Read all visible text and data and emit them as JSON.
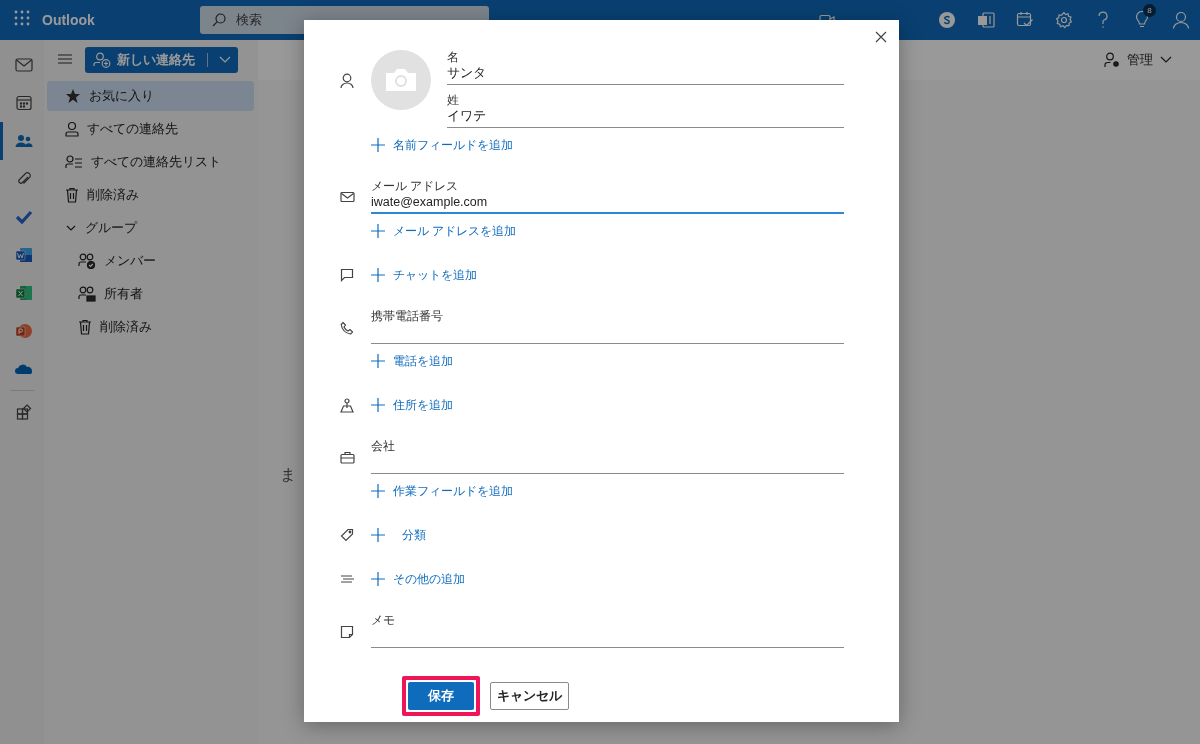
{
  "topbar": {
    "app_name": "Outlook",
    "search": {
      "placeholder": "検索"
    },
    "tips_badge": "8"
  },
  "toolbar": {
    "new_contact": "新しい連絡先",
    "manage": "管理"
  },
  "rail": [
    {
      "kind": "mail",
      "selected": false
    },
    {
      "kind": "calendar",
      "selected": false
    },
    {
      "kind": "people",
      "selected": true
    },
    {
      "kind": "files",
      "selected": false
    },
    {
      "kind": "todo",
      "selected": false
    },
    {
      "kind": "word",
      "selected": false
    },
    {
      "kind": "excel",
      "selected": false
    },
    {
      "kind": "powerpoint",
      "selected": false
    },
    {
      "kind": "onedrive",
      "selected": false
    },
    {
      "kind": "apps",
      "selected": false
    }
  ],
  "sidebar": {
    "items": [
      {
        "kind": "favorites",
        "label": "お気に入り",
        "selected": true
      },
      {
        "kind": "contacts",
        "label": "すべての連絡先",
        "selected": false
      },
      {
        "kind": "lists",
        "label": "すべての連絡先リスト",
        "selected": false
      },
      {
        "kind": "deleted",
        "label": "削除済み",
        "selected": false
      },
      {
        "kind": "group",
        "label": "グループ",
        "selected": false,
        "expanded": true,
        "children": [
          {
            "kind": "members",
            "label": "メンバー",
            "selected": false
          },
          {
            "kind": "owners",
            "label": "所有者",
            "selected": false
          },
          {
            "kind": "deleted",
            "label": "削除済み",
            "selected": false
          }
        ]
      }
    ]
  },
  "content": {
    "message": "ま"
  },
  "dialog": {
    "sections": [
      {
        "kind": "name",
        "fields": [
          {
            "label": "名",
            "value": "サンタ",
            "focused": false
          },
          {
            "label": "姓",
            "value": "イワテ",
            "focused": false
          }
        ],
        "add_link": "名前フィールドを追加"
      },
      {
        "kind": "email",
        "fields": [
          {
            "label": "メール アドレス",
            "value": "iwate@example.com",
            "focused": true
          }
        ],
        "add_link": "メール アドレスを追加"
      },
      {
        "kind": "chat",
        "add_link": "チャットを追加"
      },
      {
        "kind": "phone",
        "fields": [
          {
            "label": "携帯電話番号",
            "focused": false
          }
        ],
        "add_link": "電話を追加"
      },
      {
        "kind": "address",
        "add_link": "住所を追加"
      },
      {
        "kind": "company",
        "fields": [
          {
            "label": "会社",
            "focused": false
          }
        ],
        "add_link": "作業フィールドを追加"
      },
      {
        "kind": "category",
        "add_link": "分類"
      },
      {
        "kind": "other",
        "add_link": "その他の追加"
      },
      {
        "kind": "notes",
        "fields": [
          {
            "label": "メモ",
            "focused": false
          }
        ]
      }
    ],
    "save": {
      "label": "保存",
      "highlighted": true
    },
    "cancel": "キャンセル"
  }
}
